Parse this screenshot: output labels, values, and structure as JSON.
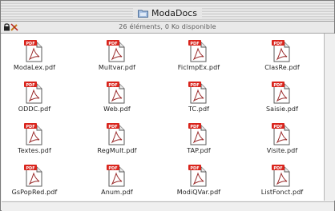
{
  "window": {
    "title": "ModaDocs",
    "info": "26 éléments, 0  Ko disponible"
  },
  "icons": {
    "folder": "folder-icon",
    "lock": "lock-icon",
    "pencil": "crossed-pencil-icon",
    "file": "pdf-file-icon",
    "file_badge": "PDF"
  },
  "files": [
    {
      "name": "ModaLex.pdf"
    },
    {
      "name": "Multvar.pdf"
    },
    {
      "name": "FicImpEx.pdf"
    },
    {
      "name": "ClasRe.pdf"
    },
    {
      "name": "ODDC.pdf"
    },
    {
      "name": "Web.pdf"
    },
    {
      "name": "TC.pdf"
    },
    {
      "name": "Saisie.pdf"
    },
    {
      "name": "Textes.pdf"
    },
    {
      "name": "RegMult.pdf"
    },
    {
      "name": "TAP.pdf"
    },
    {
      "name": "Visite.pdf"
    },
    {
      "name": "GsPopRed.pdf"
    },
    {
      "name": "Anum.pdf"
    },
    {
      "name": "ModiQVar.pdf"
    },
    {
      "name": "ListFonct.pdf"
    }
  ]
}
